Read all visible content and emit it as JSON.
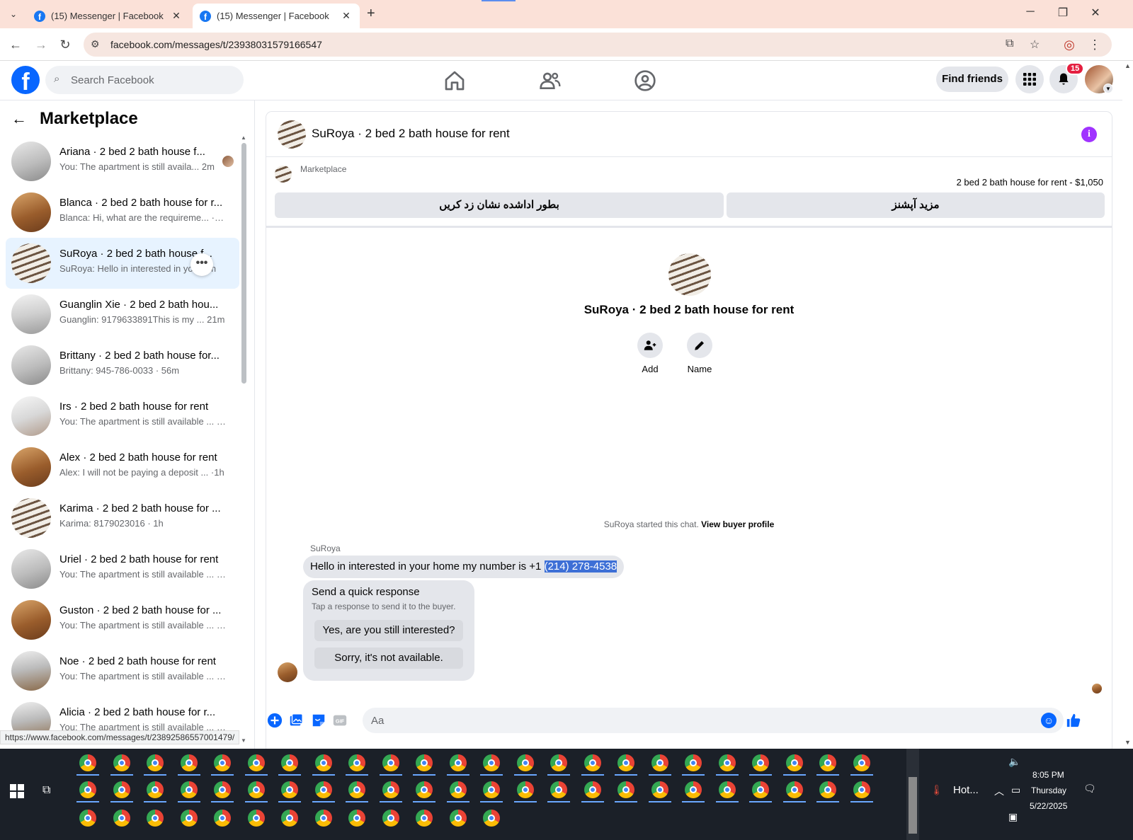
{
  "browser": {
    "tabs": [
      {
        "title": "(15) Messenger | Facebook",
        "active": false
      },
      {
        "title": "(15) Messenger | Facebook",
        "active": true
      }
    ],
    "url": "facebook.com/messages/t/23938031579166547",
    "status_url": "https://www.facebook.com/messages/t/23892586557001479/"
  },
  "header": {
    "search_placeholder": "Search Facebook",
    "find_friends": "Find friends",
    "notification_count": "15"
  },
  "sidebar": {
    "title": "Marketplace",
    "conversations": [
      {
        "title": "Ariana · 2 bed 2 bath house f...",
        "subtitle": "You: The apartment is still availa... 2m",
        "thumb": "g-room1",
        "seen": true
      },
      {
        "title": "Blanca · 2 bed 2 bath house for r...",
        "subtitle": "Blanca: Hi, what are the requireme... ·4m",
        "thumb": "g-wood"
      },
      {
        "title": "SuRoya · 2 bed 2 bath house f...",
        "subtitle": "SuRoya: Hello in interested in you... m",
        "thumb": "g-stairs",
        "active": true
      },
      {
        "title": "Guanglin Xie · 2 bed 2 bath hou...",
        "subtitle": "Guanglin: 9179633891This is my ... 21m",
        "thumb": "g-gray"
      },
      {
        "title": "Brittany · 2 bed 2 bath house for...",
        "subtitle": "Brittany: 945-786-0033 · 56m",
        "thumb": "g-room1"
      },
      {
        "title": "Irs · 2 bed 2 bath house for rent",
        "subtitle": "You: The apartment is still available ... 1h",
        "thumb": "g-kitchen"
      },
      {
        "title": "Alex · 2 bed 2 bath house for rent",
        "subtitle": "Alex: I will not be paying a deposit ... ·1h",
        "thumb": "g-wood"
      },
      {
        "title": "Karima · 2 bed 2 bath house for ...",
        "subtitle": "Karima: 8179023016 · 1h",
        "thumb": "g-stairs"
      },
      {
        "title": "Uriel · 2 bed 2 bath house for rent",
        "subtitle": "You: The apartment is still available ... 1h",
        "thumb": "g-room1"
      },
      {
        "title": "Guston · 2 bed 2 bath house for ...",
        "subtitle": "You: The apartment is still available ... 1h",
        "thumb": "g-wood"
      },
      {
        "title": "Noe · 2 bed 2 bath house for rent",
        "subtitle": "You: The apartment is still available ... 1h",
        "thumb": "g-floor"
      },
      {
        "title": "Alicia · 2 bed 2 bath house for r...",
        "subtitle": "You: The apartment is still available ... 1h",
        "thumb": "g-floor"
      }
    ]
  },
  "chat": {
    "title": "SuRoya · 2 bed 2 bath house for rent",
    "marketplace_label": "Marketplace",
    "listing": "2 bed 2 bath house for rent - $1,050",
    "mark_pending_button": "بطور اداشده نشان زد کریں",
    "more_options_button": "مزید آپشنز",
    "center_title": "SuRoya · 2 bed 2 bath house for rent",
    "actions": {
      "add": "Add",
      "name": "Name"
    },
    "started_text": "SuRoya started this chat.",
    "view_profile": "View buyer profile",
    "sender": "SuRoya",
    "message_prefix": "Hello in interested in your home my number is +1 ",
    "message_highlight": "(214) 278-4538",
    "quick_title": "Send a quick response",
    "quick_sub": "Tap a response to send it to the buyer.",
    "quick_options": [
      "Yes, are you still interested?",
      "Sorry, it's not available."
    ],
    "composer_placeholder": "Aa"
  },
  "taskbar": {
    "weather": "Hot...",
    "time": "8:05 PM",
    "day": "Thursday",
    "date": "5/22/2025"
  },
  "colors": {
    "fb_blue": "#0866ff",
    "highlight": "#3d6fd6",
    "badge_red": "#e41e3f",
    "info_purple": "#a033ff"
  }
}
